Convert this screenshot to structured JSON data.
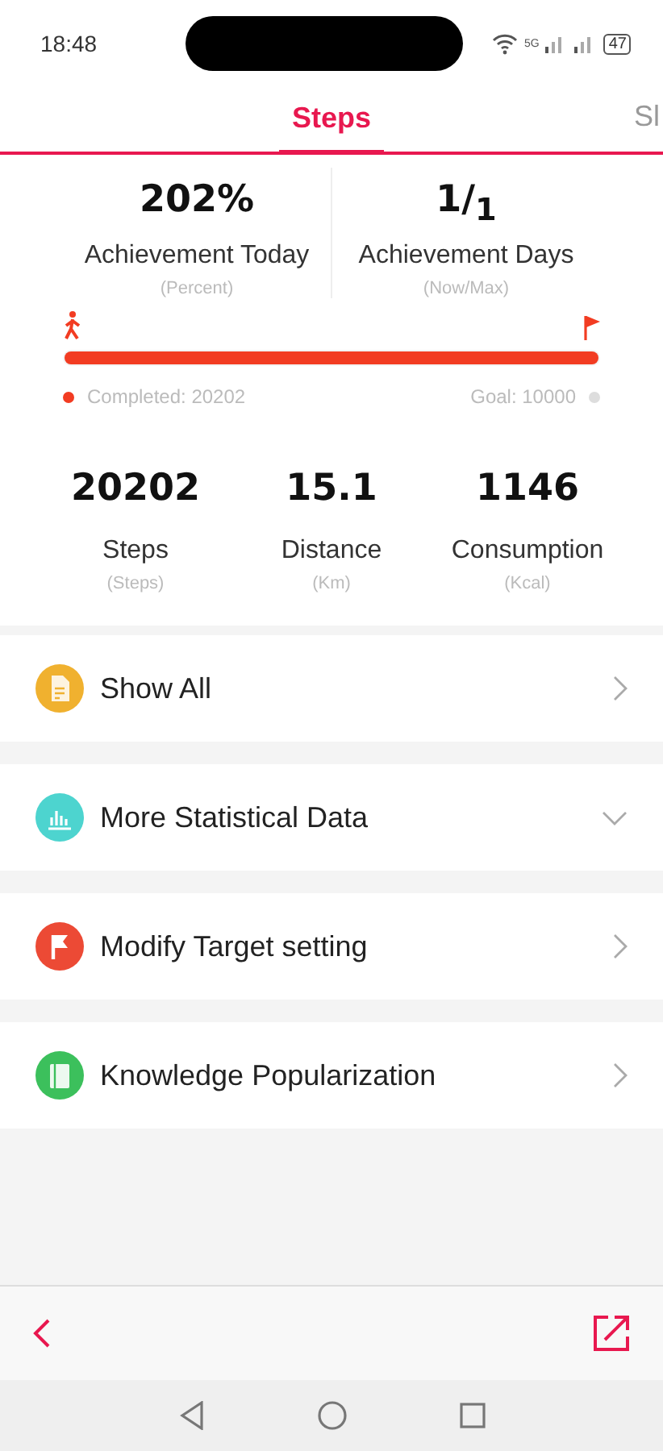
{
  "status_bar": {
    "time": "18:48",
    "network": "5G",
    "battery": "47"
  },
  "tabs": [
    {
      "label": "Steps",
      "selected": true
    },
    {
      "label": "Sl",
      "selected": false
    }
  ],
  "summary": [
    {
      "value": "202%",
      "label": "Achievement Today",
      "unit": "(Percent)"
    },
    {
      "value": "1/$_{1}$",
      "label": "Achievement Days",
      "unit": "(Now/Max)"
    }
  ],
  "progress": {
    "level": 1.0,
    "completed": "Completed:  20202",
    "goal": "Goal:  10000"
  },
  "stats": [
    {
      "value": "20202",
      "label": "Steps",
      "unit": "(Steps)"
    },
    {
      "value": "15.1",
      "label": "Distance",
      "unit": "(Km)"
    },
    {
      "value": "1146",
      "label": "Consumption",
      "unit": "(Kcal)"
    }
  ],
  "menu": [
    {
      "label": "Show All",
      "color": "#f0b12f",
      "kind": "link"
    },
    {
      "label": "More Statistical Data",
      "color": "#4dd4cf",
      "kind": "expand"
    },
    {
      "label": "Modify Target setting",
      "color": "#ec4a35",
      "kind": "link"
    },
    {
      "label": "Knowledge Popularization",
      "color": "#3cc05c",
      "kind": "link"
    }
  ]
}
